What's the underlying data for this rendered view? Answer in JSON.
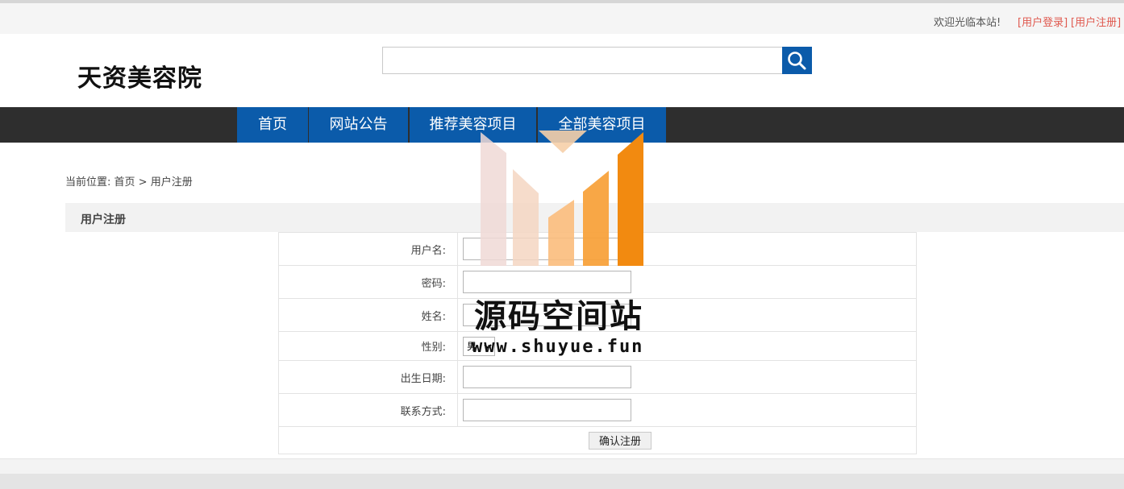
{
  "topbar": {
    "welcome": "欢迎光临本站!",
    "login_link": "[用户登录]",
    "register_link": "[用户注册]"
  },
  "header": {
    "site_name": "天资美容院",
    "search": {
      "placeholder": "",
      "value": ""
    }
  },
  "nav": {
    "items": [
      {
        "label": "首页"
      },
      {
        "label": "网站公告"
      },
      {
        "label": "推荐美容项目"
      },
      {
        "label": "全部美容项目"
      }
    ]
  },
  "breadcrumb": {
    "prefix": "当前位置: ",
    "home": "首页",
    "separator": " > ",
    "current": "用户注册"
  },
  "section": {
    "title": "用户注册"
  },
  "form": {
    "username_label": "用户名:",
    "password_label": "密码:",
    "name_label": "姓名:",
    "gender_label": "性别:",
    "gender_selected": "男",
    "birthday_label": "出生日期:",
    "contact_label": "联系方式:",
    "submit_label": "确认注册"
  },
  "watermark": {
    "title": "源码空间站",
    "url": "www.shuyue.fun"
  },
  "colors": {
    "nav_active_bg": "#0b5baa",
    "nav_bar_bg": "#2e2e2e",
    "link_red": "#e0594f",
    "search_button_bg": "#0b5baa"
  },
  "icons": {
    "search_button": "search-icon"
  }
}
